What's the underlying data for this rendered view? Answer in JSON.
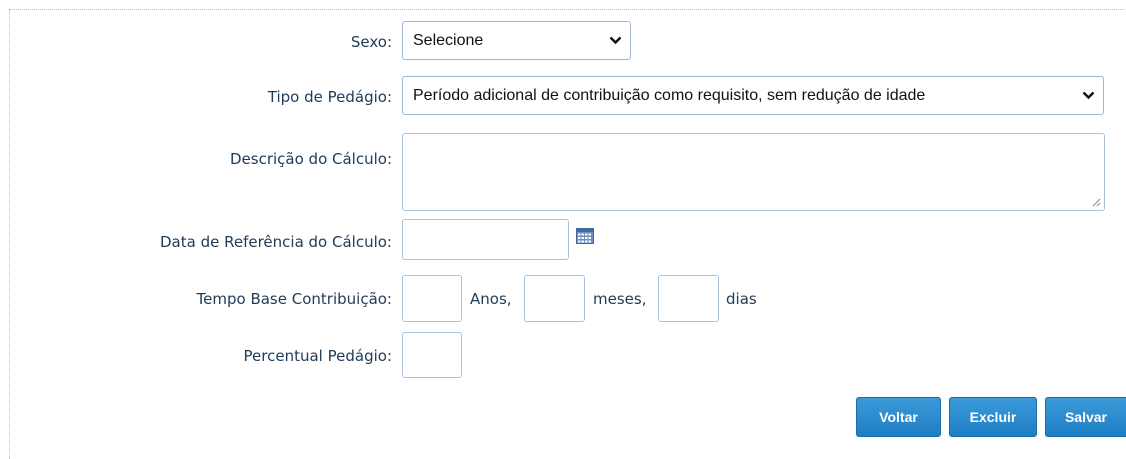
{
  "form": {
    "sexo": {
      "label": "Sexo:",
      "value": "Selecione"
    },
    "tipo_pedagio": {
      "label": "Tipo de Pedágio:",
      "value": "Período adicional de contribuição como requisito, sem redução de idade"
    },
    "descricao": {
      "label": "Descrição do Cálculo:",
      "value": ""
    },
    "data_referencia": {
      "label": "Data de Referência do Cálculo:",
      "value": ""
    },
    "tempo_base": {
      "label": "Tempo Base Contribuição:",
      "anos": "",
      "meses": "",
      "dias": "",
      "anos_label": "Anos,",
      "meses_label": "meses,",
      "dias_label": "dias"
    },
    "percentual": {
      "label": "Percentual Pedágio:",
      "value": ""
    }
  },
  "buttons": {
    "voltar": "Voltar",
    "excluir": "Excluir",
    "salvar": "Salvar"
  },
  "icons": {
    "dropdown": "chevron-down-icon",
    "calendar": "calendar-icon",
    "resize": "resize-handle-icon"
  },
  "colors": {
    "button": "#2a8bd0",
    "label": "#1f3b57",
    "border": "#a9c2da"
  }
}
